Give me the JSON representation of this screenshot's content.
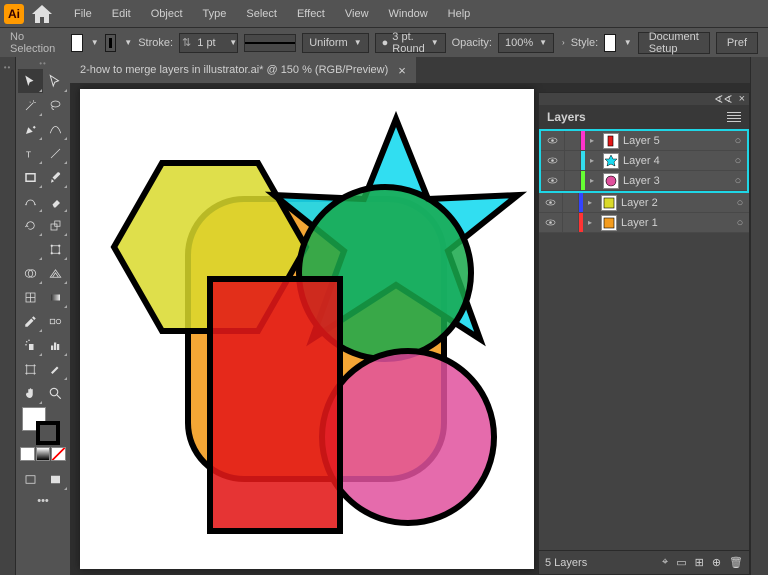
{
  "app_badge": "Ai",
  "menu": [
    "File",
    "Edit",
    "Object",
    "Type",
    "Select",
    "Effect",
    "View",
    "Window",
    "Help"
  ],
  "optionbar": {
    "no_selection": "No Selection",
    "stroke_label": "Stroke:",
    "stroke_value": "1 pt",
    "profile": "Uniform",
    "brush_value": "3 pt. Round",
    "opacity_label": "Opacity:",
    "opacity_value": "100%",
    "style_label": "Style:",
    "doc_setup": "Document Setup",
    "prefs": "Pref"
  },
  "tab_title": "2-how to merge layers in illustrator.ai* @ 150 % (RGB/Preview)",
  "layers_panel": {
    "title": "Layers",
    "highlighted": [
      {
        "name": "Layer 5",
        "color": "#ff33cc",
        "thumb": "rect-red"
      },
      {
        "name": "Layer 4",
        "color": "#33ddee",
        "thumb": "star-cyan"
      },
      {
        "name": "Layer 3",
        "color": "#66ff33",
        "thumb": "circle-pink"
      }
    ],
    "others": [
      {
        "name": "Layer 2",
        "color": "#3344ff",
        "thumb": "sq-yellow"
      },
      {
        "name": "Layer 1",
        "color": "#ff3333",
        "thumb": "sq-orange"
      }
    ],
    "footer": "5 Layers"
  }
}
